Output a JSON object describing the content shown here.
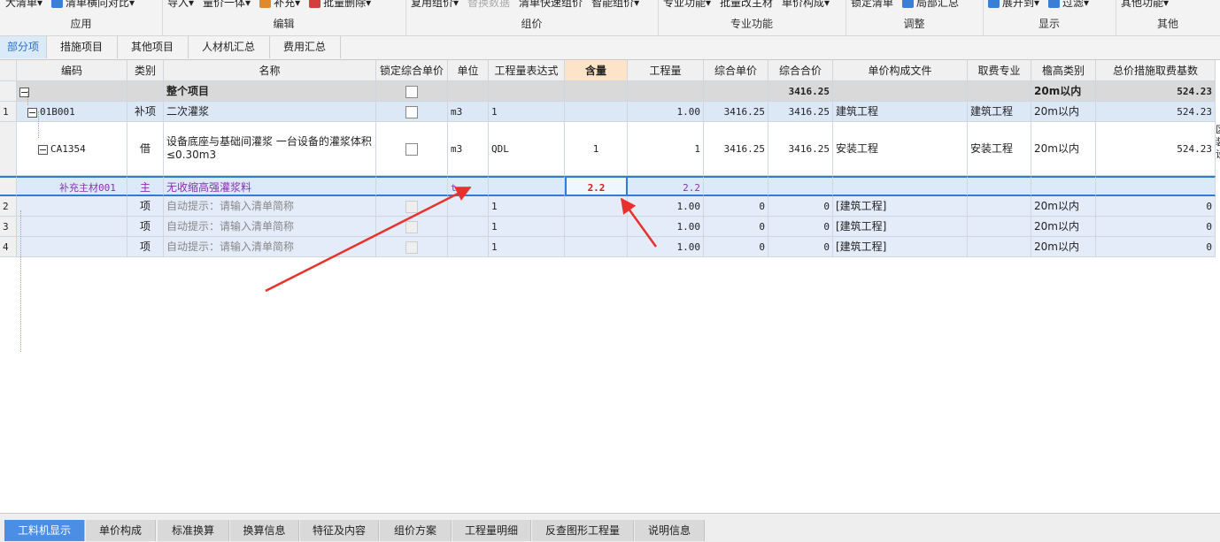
{
  "ribbon": {
    "groups": [
      {
        "label": "应用",
        "buttons": [
          {
            "text": "大清单▾",
            "icon": "",
            "disabled": false
          },
          {
            "text": "清单横向对比▾",
            "icon": "#3a7fd5",
            "disabled": false
          }
        ]
      },
      {
        "label": "编辑",
        "buttons": [
          {
            "text": "导入▾",
            "icon": "",
            "disabled": false
          },
          {
            "text": "量价一体▾",
            "icon": "",
            "disabled": false
          },
          {
            "text": "补充▾",
            "icon": "#e08a2b",
            "disabled": false
          },
          {
            "text": "批量删除▾",
            "icon": "#d23f3f",
            "disabled": false
          }
        ]
      },
      {
        "label": "组价",
        "buttons": [
          {
            "text": "复用组价▾",
            "icon": "",
            "disabled": false
          },
          {
            "text": "替换数据",
            "icon": "",
            "disabled": true
          },
          {
            "text": "清单快速组价",
            "icon": "",
            "disabled": false
          },
          {
            "text": "智能组价▾",
            "icon": "",
            "disabled": false
          }
        ]
      },
      {
        "label": "专业功能",
        "buttons": [
          {
            "text": "专业功能▾",
            "icon": "",
            "disabled": false
          },
          {
            "text": "批量改主材",
            "icon": "",
            "disabled": false
          },
          {
            "text": "单价构成▾",
            "icon": "",
            "disabled": false
          }
        ]
      },
      {
        "label": "调整",
        "buttons": [
          {
            "text": "锁定清单",
            "icon": "",
            "disabled": false
          },
          {
            "text": "局部汇总",
            "icon": "#3a7fd5",
            "disabled": false
          }
        ]
      },
      {
        "label": "显示",
        "buttons": [
          {
            "text": "展开到▾",
            "icon": "#3a7fd5",
            "disabled": false
          },
          {
            "text": "过滤▾",
            "icon": "#3a7fd5",
            "disabled": false
          }
        ]
      },
      {
        "label": "其他",
        "buttons": [
          {
            "text": "其他功能▾",
            "icon": "",
            "disabled": false
          }
        ]
      }
    ]
  },
  "tabs": [
    "部分项",
    "措施项目",
    "其他项目",
    "人材机汇总",
    "费用汇总"
  ],
  "table": {
    "headers": [
      "",
      "编码",
      "类别",
      "名称",
      "锁定综合单价",
      "单位",
      "工程量表达式",
      "含量",
      "工程量",
      "综合单价",
      "综合合价",
      "单价构成文件",
      "取费专业",
      "檐高类别",
      "总价措施取费基数"
    ],
    "rows": [
      {
        "type": "total",
        "num": "",
        "code": "",
        "category": "",
        "name": "整个项目",
        "unit": "",
        "expr": "",
        "content": "",
        "qty": "",
        "unit_price": "",
        "total": "3416.25",
        "file": "",
        "major": "",
        "height": "20m以内",
        "base": "524.23"
      },
      {
        "type": "bill",
        "num": "1",
        "code": "01B001",
        "category": "补项",
        "name": "二次灌浆",
        "unit": "m3",
        "expr": "1",
        "content": "",
        "qty": "1.00",
        "unit_price": "3416.25",
        "total": "3416.25",
        "file": "建筑工程",
        "major": "建筑工程",
        "height": "20m以内",
        "base": "524.23"
      },
      {
        "type": "quota",
        "num": "",
        "code": "CA1354",
        "category": "借",
        "name": "设备底座与基础间灌浆 一台设备的灌浆体积≤0.30m3",
        "unit": "m3",
        "expr": "QDL",
        "content": "1",
        "qty": "1",
        "unit_price": "3416.25",
        "total": "3416.25",
        "file": "安装工程",
        "major": "安装工程",
        "height": "20m以内",
        "base": "524.23",
        "overflow": "区 装 设"
      },
      {
        "type": "material",
        "num": "",
        "code": "补充主材001",
        "category": "主",
        "name": "无收缩高强灌浆料",
        "unit": "t",
        "expr": "",
        "content": "2.2",
        "qty": "2.2",
        "unit_price": "",
        "total": "",
        "file": "",
        "major": "",
        "height": "",
        "base": ""
      },
      {
        "type": "empty",
        "num": "2",
        "code": "",
        "category": "项",
        "name": "自动提示：请输入清单简称",
        "unit": "",
        "expr": "1",
        "content": "",
        "qty": "1.00",
        "unit_price": "0",
        "total": "0",
        "file": "[建筑工程]",
        "major": "",
        "height": "20m以内",
        "base": "0"
      },
      {
        "type": "empty",
        "num": "3",
        "code": "",
        "category": "项",
        "name": "自动提示：请输入清单简称",
        "unit": "",
        "expr": "1",
        "content": "",
        "qty": "1.00",
        "unit_price": "0",
        "total": "0",
        "file": "[建筑工程]",
        "major": "",
        "height": "20m以内",
        "base": "0"
      },
      {
        "type": "empty",
        "num": "4",
        "code": "",
        "category": "项",
        "name": "自动提示：请输入清单简称",
        "unit": "",
        "expr": "1",
        "content": "",
        "qty": "1.00",
        "unit_price": "0",
        "total": "0",
        "file": "[建筑工程]",
        "major": "",
        "height": "20m以内",
        "base": "0"
      }
    ]
  },
  "bottom_tabs": [
    "工料机显示",
    "单价构成",
    "标准换算",
    "换算信息",
    "特征及内容",
    "组价方案",
    "工程量明细",
    "反查图形工程量",
    "说明信息"
  ],
  "colors": {
    "accent": "#4a8ee6",
    "selection_border": "#2f7bd8",
    "arrow": "#e8312b",
    "material_text": "#8a2fb0",
    "content_value": "#d01b1b"
  }
}
